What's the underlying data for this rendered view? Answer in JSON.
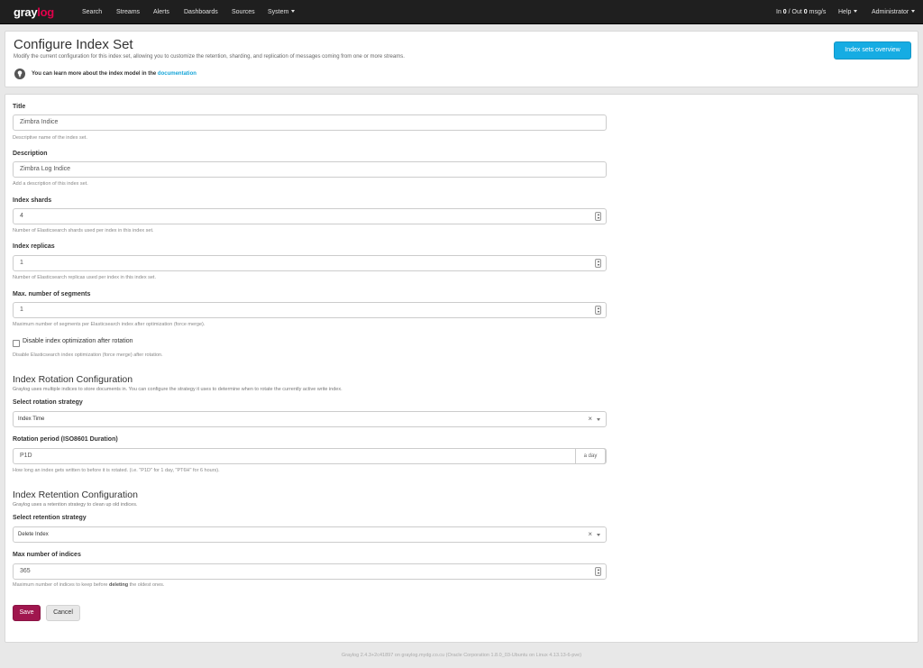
{
  "nav": {
    "logo_main": "gray",
    "logo_accent": "log",
    "items": [
      "Search",
      "Streams",
      "Alerts",
      "Dashboards",
      "Sources",
      "System"
    ],
    "throughput_in_label": "In",
    "throughput_in": "0",
    "throughput_sep": "/ Out",
    "throughput_out": "0",
    "throughput_unit": "msg/s",
    "help": "Help",
    "user": "Administrator"
  },
  "header": {
    "title": "Configure Index Set",
    "description": "Modify the current configuration for this index set, allowing you to customize the retention, sharding, and replication of messages coming from one or more streams.",
    "learn_prefix": "You can learn more about the index model in the",
    "learn_link": "documentation",
    "overview_button": "Index sets overview"
  },
  "form": {
    "title": {
      "label": "Title",
      "value": "Zimbra Indice",
      "help": "Descriptive name of the index set."
    },
    "description": {
      "label": "Description",
      "value": "Zimbra Log Indice",
      "help": "Add a description of this index set."
    },
    "shards": {
      "label": "Index shards",
      "value": "4",
      "help": "Number of Elasticsearch shards used per index in this index set."
    },
    "replicas": {
      "label": "Index replicas",
      "value": "1",
      "help": "Number of Elasticsearch replicas used per index in this index set."
    },
    "segments": {
      "label": "Max. number of segments",
      "value": "1",
      "help": "Maximum number of segments per Elasticsearch index after optimization (force merge)."
    },
    "disable_opt": {
      "label": "Disable index optimization after rotation",
      "checked": false,
      "help": "Disable Elasticsearch index optimization (force merge) after rotation."
    },
    "rotation": {
      "section_title": "Index Rotation Configuration",
      "section_desc": "Graylog uses multiple indices to store documents in. You can configure the strategy it uses to determine when to rotate the currently active write index.",
      "strategy_label": "Select rotation strategy",
      "strategy_value": "Index Time",
      "period_label": "Rotation period (ISO8601 Duration)",
      "period_value": "P1D",
      "period_addon": "a day",
      "period_help": "How long an index gets written to before it is rotated. (i.e. \"P1D\" for 1 day, \"PT6H\" for 6 hours)."
    },
    "retention": {
      "section_title": "Index Retention Configuration",
      "section_desc": "Graylog uses a retention strategy to clean up old indices.",
      "strategy_label": "Select retention strategy",
      "strategy_value": "Delete Index",
      "max_label": "Max number of indices",
      "max_value": "365",
      "max_help_prefix": "Maximum number of indices to keep before",
      "max_help_bold": "deleting",
      "max_help_suffix": "the oldest ones."
    },
    "save_button": "Save",
    "cancel_button": "Cancel"
  },
  "footer": "Graylog 2.4.3+2c41897 on graylog.mydg.co.cu (Oracle Corporation 1.8.0_03-Ubuntu on Linux 4.13.13-6-pve)",
  "colors": {
    "brand": "#e2004b",
    "primary": "#a0164e",
    "info": "#16ace3",
    "navbar": "#1f1f1f"
  }
}
